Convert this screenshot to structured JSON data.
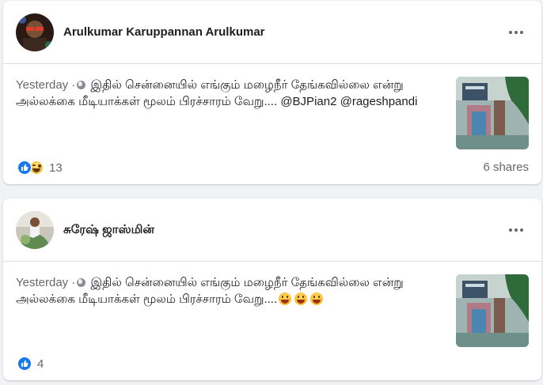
{
  "posts": [
    {
      "author": "Arulkumar Karuppannan Arulkumar",
      "time": "Yesterday",
      "separator": "·",
      "text": "இதில் சென்னையில் எங்கும் மழைநீர் தேங்கவில்லை என்று அல்லக்கை மீடியாக்கள் மூலம் பிரச்சாரம் வேறு....",
      "mentions": [
        "@BJPian2",
        "@rageshpandi"
      ],
      "reactions": [
        "like",
        "haha"
      ],
      "reaction_count": "13",
      "shares": "6 shares"
    },
    {
      "author": "சுரேஷ் ஜாஸ்மின்",
      "time": "Yesterday",
      "separator": "·",
      "text": "இதில் சென்னையில் எங்கும் மழைநீர் தேங்கவில்லை என்று அல்லக்கை மீடியாக்கள் மூலம் பிரச்சாரம் வேறு....",
      "emojis": [
        "grinning-face",
        "grinning-face",
        "grinning-face"
      ],
      "reactions": [
        "like"
      ],
      "reaction_count": "4"
    }
  ],
  "colors": {
    "background": "#f0f2f5",
    "card": "#ffffff",
    "text": "#1c1e21",
    "secondary": "#65676b",
    "like_blue": "#1877f2"
  }
}
